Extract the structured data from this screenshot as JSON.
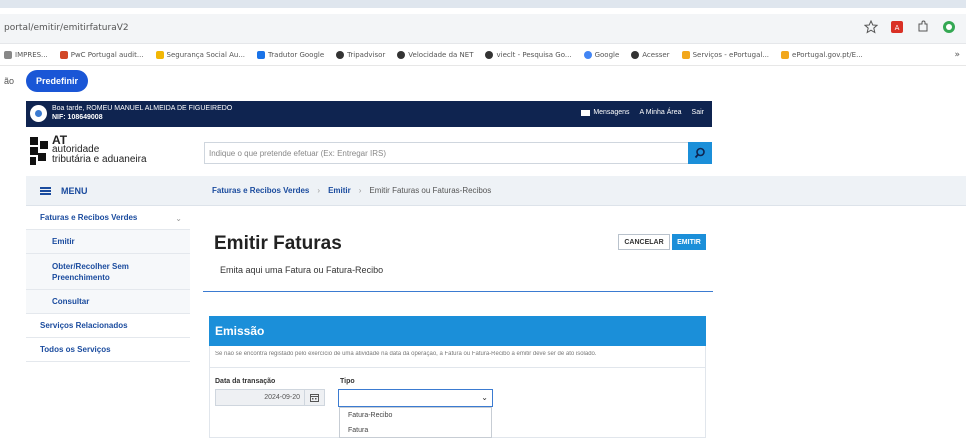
{
  "browser": {
    "url": "portal/emitir/emitirfaturaV2",
    "bookmarks": [
      {
        "label": "IMPRES...",
        "color": "#888888"
      },
      {
        "label": "PwC Portugal audit...",
        "color": "#d24726"
      },
      {
        "label": "Segurança Social Au...",
        "color": "#f2b705"
      },
      {
        "label": "Tradutor Google",
        "color": "#1a73e8"
      },
      {
        "label": "Tripadvisor",
        "color": "#333333"
      },
      {
        "label": "Velocidade da NET",
        "color": "#333333"
      },
      {
        "label": "vieclt - Pesquisa Go...",
        "color": "#333333"
      },
      {
        "label": "Google",
        "color": "#4285f4"
      },
      {
        "label": "Acesser",
        "color": "#333333"
      },
      {
        "label": "Serviços - ePortugal...",
        "color": "#f2a71b"
      },
      {
        "label": "ePortugal.gov.pt/E...",
        "color": "#f2a71b"
      }
    ],
    "ext_left_label": "ão",
    "predef_label": "Predefinir",
    "more_label": "»"
  },
  "topbar": {
    "greeting": "Boa tarde, ROMEU MANUEL ALMEIDA DE FIGUEIREDO",
    "nif": "NIF: 108649008",
    "links": [
      "Mensagens",
      "A Minha Área",
      "Sair"
    ]
  },
  "header": {
    "logo_line1": "AT",
    "logo_line2": "autoridade",
    "logo_line3": "tributária e aduaneira",
    "search_placeholder": "Indique o que pretende efetuar (Ex: Entregar IRS)"
  },
  "sidebar": {
    "menu_label": "MENU",
    "items": [
      {
        "label": "Faturas e Recibos Verdes",
        "level": 1
      },
      {
        "label": "Emitir",
        "level": 2
      },
      {
        "label": "Obter/Recolher Sem Preenchimento",
        "level": 2
      },
      {
        "label": "Consultar",
        "level": 2
      },
      {
        "label": "Serviços Relacionados",
        "level": 1
      },
      {
        "label": "Todos os Serviços",
        "level": 1
      }
    ]
  },
  "breadcrumb": [
    "Faturas e Recibos Verdes",
    "Emitir",
    "Emitir Faturas ou Faturas-Recibos"
  ],
  "main": {
    "title": "Emitir Faturas",
    "subtitle": "Emita aqui uma Fatura ou Fatura-Recibo",
    "cancel_label": "CANCELAR",
    "emit_label": "EMITIR",
    "panel_title": "Emissão",
    "panel_note": "Se não se encontra registado pelo exercício de uma atividade na data da operação, a Fatura ou Fatura-Recibo a emitir deve ser de ato isolado.",
    "date_label": "Data da transação",
    "date_value": "2024-09-20",
    "type_label": "Tipo",
    "type_value": "",
    "type_options": [
      "Fatura-Recibo",
      "Fatura"
    ]
  },
  "colors": {
    "navy": "#0f2450",
    "accent": "#1b8fd9",
    "link": "#1a4b9e"
  }
}
